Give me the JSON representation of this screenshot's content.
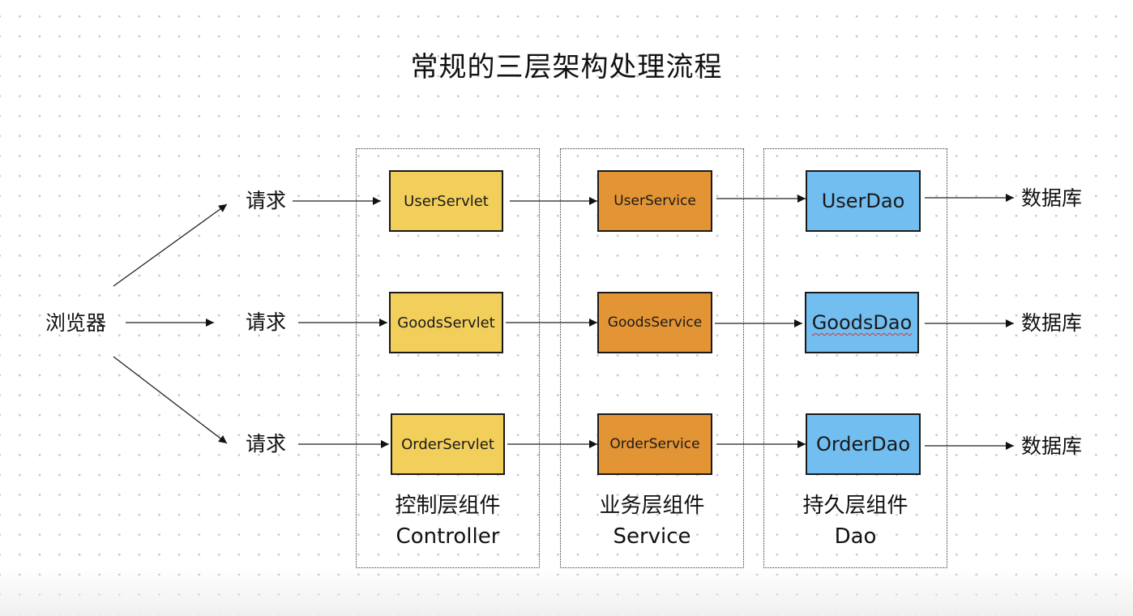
{
  "title": "常规的三层架构处理流程",
  "browser": "浏览器",
  "request_label": "请求",
  "database_label": "数据库",
  "layers": {
    "controller": {
      "name_cn": "控制层组件",
      "name_en": "Controller",
      "components": [
        "UserServlet",
        "GoodsServlet",
        "OrderServlet"
      ]
    },
    "service": {
      "name_cn": "业务层组件",
      "name_en": "Service",
      "components": [
        "UserService",
        "GoodsService",
        "OrderService"
      ]
    },
    "dao": {
      "name_cn": "持久层组件",
      "name_en": "Dao",
      "components": [
        "UserDao",
        "GoodsDao",
        "OrderDao"
      ]
    }
  },
  "colors": {
    "controller": "#f2cf5b",
    "service": "#e39434",
    "dao": "#72bef0"
  }
}
